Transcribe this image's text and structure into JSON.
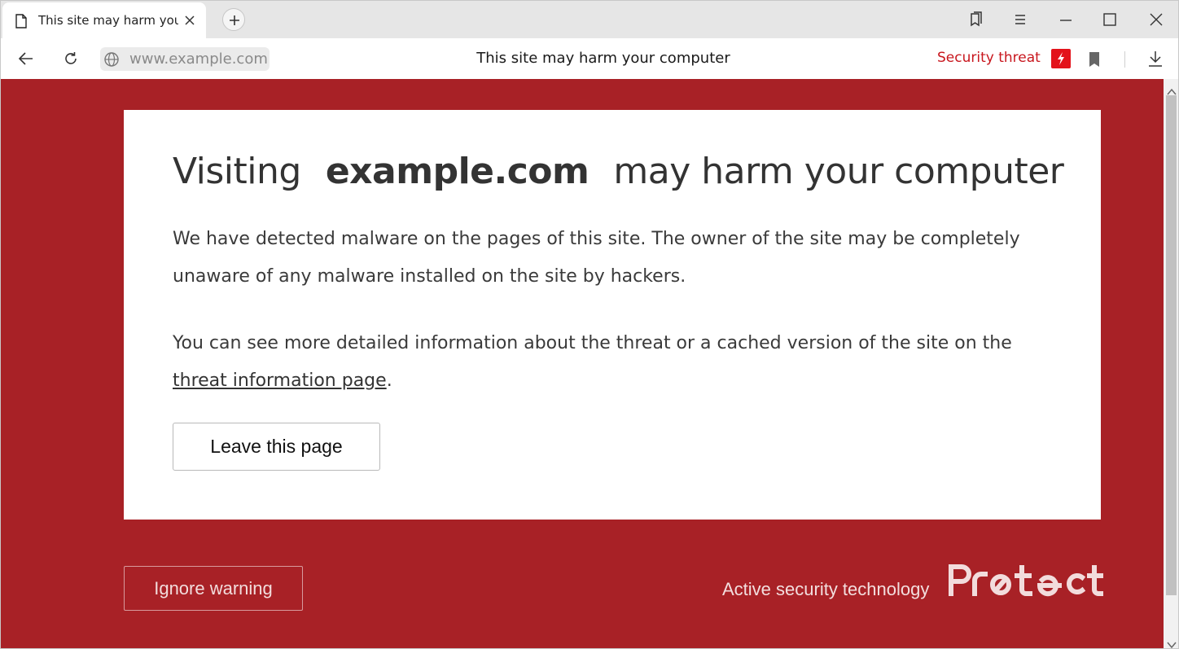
{
  "tab": {
    "title": "This site may harm your computer",
    "icon": "document-icon"
  },
  "toolbar": {
    "url": "www.example.com",
    "page_title": "This site may harm your computer",
    "security_label": "Security threat"
  },
  "warning": {
    "heading_prefix": "Visiting",
    "heading_domain": "example.com",
    "heading_suffix": "may harm your computer",
    "paragraph1": "We have detected malware on the pages of this site. The owner of the site may be completely unaware of any malware installed on the site by hackers.",
    "paragraph2_before": "You can see more detailed information about the threat or a cached version of the site on the ",
    "paragraph2_link": "threat information page",
    "paragraph2_after": ".",
    "leave_button": "Leave this page"
  },
  "footer": {
    "ignore_button": "Ignore warning",
    "active_security": "Active security technology",
    "brand": "Protect"
  },
  "colors": {
    "page_background": "#a82126",
    "security_text": "#c8161d",
    "threat_badge": "#e3131b",
    "card": "#ffffff"
  }
}
